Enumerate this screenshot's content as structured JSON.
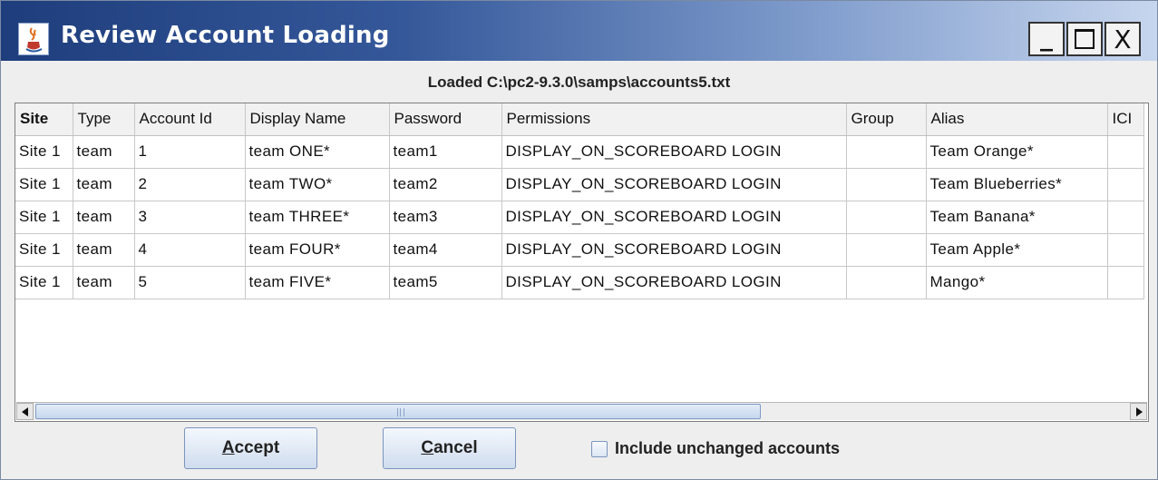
{
  "window": {
    "title": "Review Account Loading",
    "controls": {
      "minimize": "_",
      "close": "X"
    }
  },
  "loaded_label": "Loaded C:\\pc2-9.3.0\\samps\\accounts5.txt",
  "table": {
    "headers": [
      "Site",
      "Type",
      "Account Id",
      "Display Name",
      "Password",
      "Permissions",
      "Group",
      "Alias",
      "ICI"
    ],
    "rows": [
      [
        "Site 1",
        "team",
        "1",
        "team ONE*",
        "team1",
        "DISPLAY_ON_SCOREBOARD LOGIN",
        "",
        "Team Orange*",
        ""
      ],
      [
        "Site 1",
        "team",
        "2",
        "team TWO*",
        "team2",
        "DISPLAY_ON_SCOREBOARD LOGIN",
        "",
        "Team Blueberries*",
        ""
      ],
      [
        "Site 1",
        "team",
        "3",
        "team THREE*",
        "team3",
        "DISPLAY_ON_SCOREBOARD LOGIN",
        "",
        "Team Banana*",
        ""
      ],
      [
        "Site 1",
        "team",
        "4",
        "team FOUR*",
        "team4",
        "DISPLAY_ON_SCOREBOARD LOGIN",
        "",
        "Team Apple*",
        ""
      ],
      [
        "Site 1",
        "team",
        "5",
        "team FIVE*",
        "team5",
        "DISPLAY_ON_SCOREBOARD LOGIN",
        "",
        "Mango*",
        ""
      ]
    ]
  },
  "buttons": {
    "accept_first": "A",
    "accept_rest": "ccept",
    "cancel_first": "C",
    "cancel_rest": "ancel"
  },
  "include_unchanged_label": "Include unchanged accounts",
  "include_unchanged_checked": false,
  "icons": {
    "app": "java-coffee-cup-icon",
    "scroll_left": "arrow-left-icon",
    "scroll_right": "arrow-right-icon"
  }
}
